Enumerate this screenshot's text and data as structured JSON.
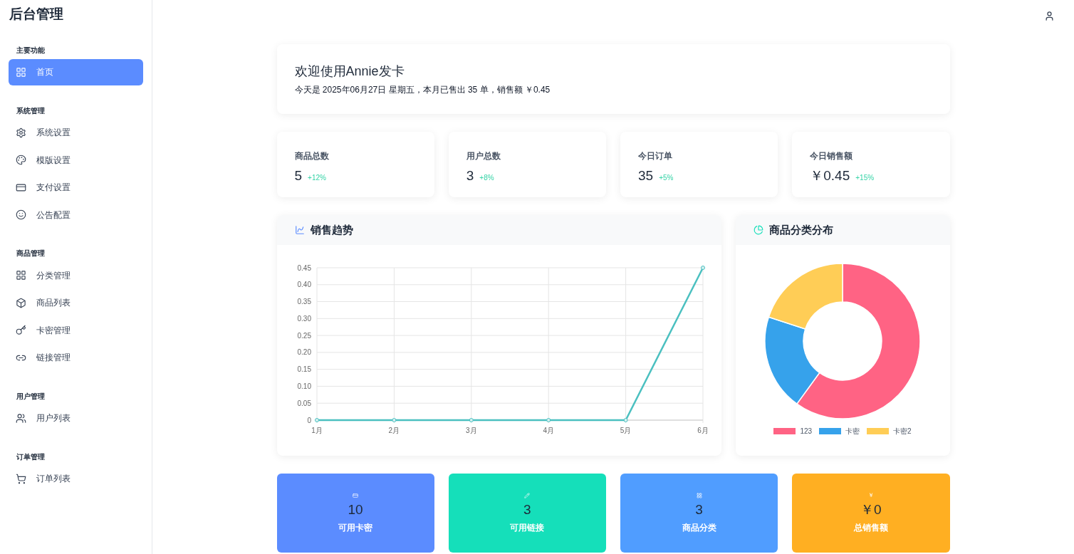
{
  "sidebar": {
    "title": "后台管理",
    "sections": [
      {
        "heading": "主要功能",
        "items": [
          {
            "label": "首页",
            "selected": true
          }
        ]
      },
      {
        "heading": "系统管理",
        "items": [
          {
            "label": "系统设置",
            "selected": false
          },
          {
            "label": "模版设置",
            "selected": false
          },
          {
            "label": "支付设置",
            "selected": false
          },
          {
            "label": "公告配置",
            "selected": false
          }
        ]
      },
      {
        "heading": "商品管理",
        "items": [
          {
            "label": "分类管理",
            "selected": false
          },
          {
            "label": "商品列表",
            "selected": false
          },
          {
            "label": "卡密管理",
            "selected": false
          },
          {
            "label": "链接管理",
            "selected": false
          }
        ]
      },
      {
        "heading": "用户管理",
        "items": [
          {
            "label": "用户列表",
            "selected": false
          }
        ]
      },
      {
        "heading": "订单管理",
        "items": [
          {
            "label": "订单列表",
            "selected": false
          }
        ]
      }
    ]
  },
  "welcome": {
    "title": "欢迎使用Annie发卡",
    "subtitle": "今天是 2025年06月27日 星期五，本月已售出 35 单，销售额 ￥0.45"
  },
  "stats": [
    {
      "label": "商品总数",
      "value": "5",
      "change": "+12%"
    },
    {
      "label": "用户总数",
      "value": "3",
      "change": "+8%"
    },
    {
      "label": "今日订单",
      "value": "35",
      "change": "+5%"
    },
    {
      "label": "今日销售额",
      "value": "￥0.45",
      "change": "+15%"
    }
  ],
  "sales_trend": {
    "title": "销售趋势",
    "chart_data": {
      "type": "line",
      "categories": [
        "1月",
        "2月",
        "3月",
        "4月",
        "5月",
        "6月"
      ],
      "series": [
        {
          "color": "#4bc0c0",
          "marker": true,
          "values": [
            0,
            0,
            0,
            0,
            0,
            0.45
          ]
        }
      ],
      "grid": true,
      "ylim": [
        0,
        0.45
      ],
      "yticks": [
        {
          "value": 0,
          "label": "0"
        },
        {
          "value": 0.05,
          "label": "0.05"
        },
        {
          "value": 0.1,
          "label": "0.10"
        },
        {
          "value": 0.15,
          "label": "0.15"
        },
        {
          "value": 0.2,
          "label": "0.20"
        },
        {
          "value": 0.25,
          "label": "0.25"
        },
        {
          "value": 0.3,
          "label": "0.30"
        },
        {
          "value": 0.35,
          "label": "0.35"
        },
        {
          "value": 0.4,
          "label": "0.40"
        },
        {
          "value": 0.45,
          "label": "0.45"
        }
      ]
    }
  },
  "category_distribution": {
    "title": "商品分类分布",
    "chart_data": {
      "type": "donut",
      "categories": [
        "123",
        "卡密",
        "卡密2"
      ],
      "values": [
        60,
        20,
        20
      ],
      "colors": [
        "#ff6384",
        "#36a2eb",
        "#ffcd56"
      ],
      "legend": "bottom"
    }
  },
  "summary": [
    {
      "kind": "card",
      "value": "10",
      "label": "可用卡密",
      "color": "#5b8cff"
    },
    {
      "kind": "link",
      "value": "3",
      "label": "可用链接",
      "color": "#15dfba"
    },
    {
      "kind": "grid",
      "value": "3",
      "label": "商品分类",
      "color": "#509dff"
    },
    {
      "kind": "currency",
      "symbol": "￥",
      "value": "￥0",
      "label": "总销售额",
      "color": "#ffaf22"
    }
  ]
}
